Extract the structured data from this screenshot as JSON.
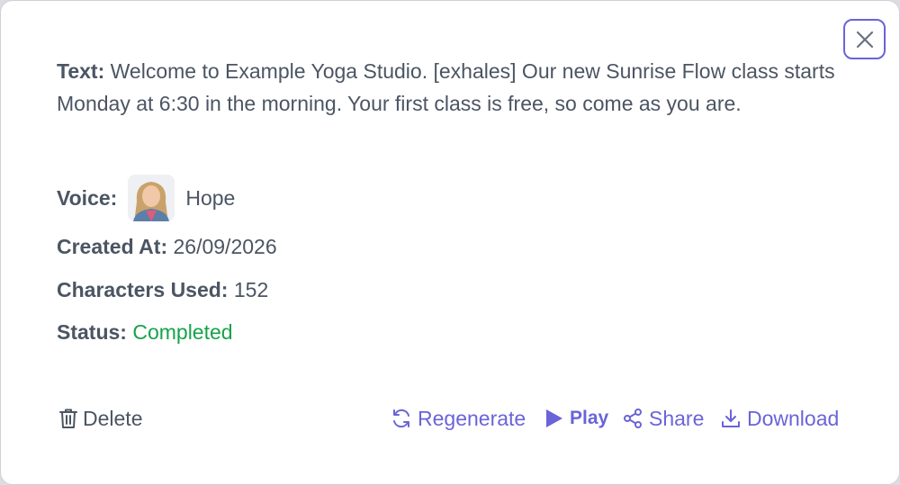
{
  "details": {
    "text_label": "Text:",
    "text_value": "Welcome to Example Yoga Studio. [exhales] Our new Sunrise Flow class starts Monday at 6:30 in the morning. Your first class is free, so come as you are.",
    "voice_label": "Voice:",
    "voice_name": "Hope",
    "created_label": "Created At:",
    "created_value": "26/09/2026",
    "chars_label": "Characters Used:",
    "chars_value": "152",
    "status_label": "Status:",
    "status_value": "Completed"
  },
  "actions": {
    "delete": "Delete",
    "regenerate": "Regenerate",
    "play": "Play",
    "share": "Share",
    "download": "Download"
  },
  "icons": {
    "close": "close-icon",
    "delete": "trash-icon",
    "regenerate": "refresh-icon",
    "play": "play-icon",
    "share": "share-icon",
    "download": "download-icon"
  },
  "colors": {
    "accent": "#6a64d8",
    "status_completed": "#16a34a",
    "text": "#4b5563"
  }
}
